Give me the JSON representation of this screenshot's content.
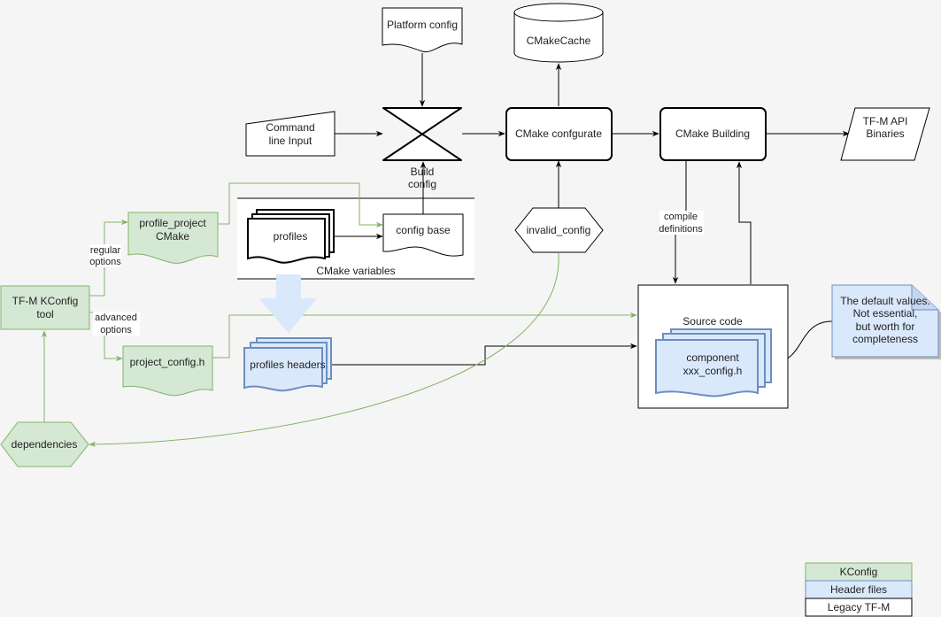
{
  "colors": {
    "background": "#f5f5f5",
    "kconfig_fill": "#d5e8d4",
    "kconfig_stroke": "#82b366",
    "header_fill": "#dae8fc",
    "header_stroke": "#6c8ebf",
    "legacy_fill": "#ffffff",
    "edge": "#000000"
  },
  "nodes": {
    "platform_config": "Platform config",
    "cmake_cache": "CMakeCache",
    "command_line_input": [
      "Command",
      "line Input"
    ],
    "build_config": [
      "Build",
      "config"
    ],
    "cmake_configurate": "CMake confgurate",
    "cmake_building": "CMake Building",
    "tfm_api_binaries": [
      "TF-M API",
      "Binaries"
    ],
    "profile_project_cmake": [
      "profile_project",
      "CMake"
    ],
    "profiles": "profiles",
    "config_base": "config base",
    "cmake_variables": "CMake variables",
    "invalid_config": "invalid_config",
    "compile_definitions": [
      "compile",
      "definitions"
    ],
    "tfm_kconfig_tool": [
      "TF-M KConfig",
      "tool"
    ],
    "regular_options": [
      "regular",
      "options"
    ],
    "advanced_options": [
      "advanced",
      "options"
    ],
    "project_config_h": "project_config.h",
    "profiles_headers": "profiles headers",
    "source_code": "Source code",
    "component_config": [
      "component",
      "xxx_config.h"
    ],
    "note": [
      "The default values.",
      "Not essential,",
      "but worth for",
      "completeness"
    ],
    "dependencies": "dependencies"
  },
  "legend": [
    {
      "label": "KConfig",
      "category": "kconfig"
    },
    {
      "label": "Header files",
      "category": "header"
    },
    {
      "label": "Legacy TF-M",
      "category": "legacy"
    }
  ]
}
